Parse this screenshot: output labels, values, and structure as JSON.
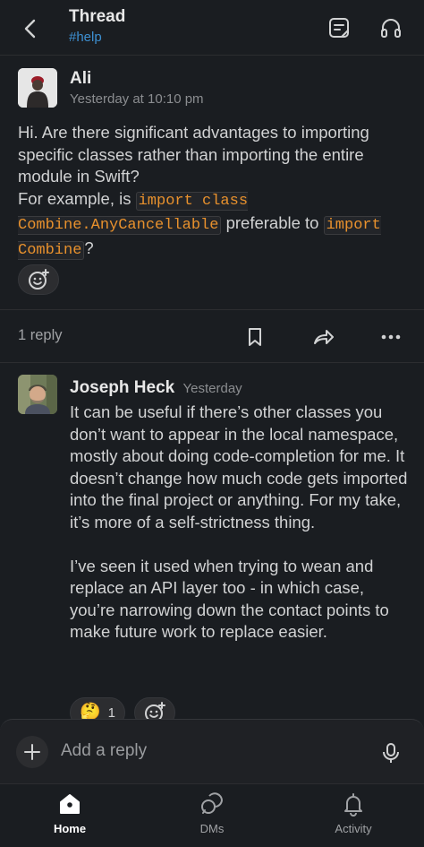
{
  "header": {
    "title": "Thread",
    "channel": "#help",
    "back_icon": "chevron-left-icon",
    "actions": [
      "note-icon",
      "headphones-icon"
    ]
  },
  "original_message": {
    "author": "Ali",
    "time": "Yesterday at 10:10 pm",
    "text_line1": "Hi. Are there significant advantages to importing specific classes rather than importing the entire module in Swift?",
    "text_pre1": "For example, is ",
    "code1": "import class Combine.AnyCancellable",
    "text_mid": " preferable to ",
    "code2": "import Combine",
    "text_end": "?",
    "add_reaction_icon": "add-emoji-icon"
  },
  "thread_actions": {
    "reply_count": "1 reply",
    "icons": [
      "bookmark-icon",
      "share-icon",
      "more-icon"
    ]
  },
  "reply": {
    "author": "Joseph Heck",
    "time": "Yesterday",
    "paragraph1": "It can be useful if there’s other classes you don’t want to appear in the local namespace, mostly about doing code-completion for me. It doesn’t change how much code gets imported into the final project or anything. For my take, it’s more of a self-strictness thing.",
    "paragraph2": "I’ve seen it used when trying to wean and replace an API layer too - in which case, you’re narrowing down the contact points to make future work to replace easier.",
    "reaction_emoji": "🤔",
    "reaction_count": "1"
  },
  "composer": {
    "placeholder": "Add a reply",
    "plus_icon": "plus-icon",
    "mic_icon": "microphone-icon"
  },
  "tabs": [
    {
      "label": "Home",
      "icon": "home-icon",
      "active": true
    },
    {
      "label": "DMs",
      "icon": "dms-icon",
      "active": false
    },
    {
      "label": "Activity",
      "icon": "bell-icon",
      "active": false
    }
  ],
  "colors": {
    "background": "#1a1d21",
    "link": "#3d8fd1",
    "code": "#e8912d"
  }
}
